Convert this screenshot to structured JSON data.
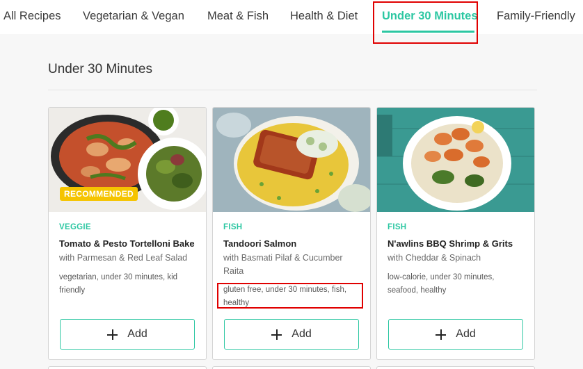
{
  "tabs": [
    "All Recipes",
    "Vegetarian & Vegan",
    "Meat & Fish",
    "Health & Diet",
    "Under 30 Minutes",
    "Family-Friendly"
  ],
  "section_title": "Under 30 Minutes",
  "cards": [
    {
      "badge": "RECOMMENDED",
      "category": "VEGGIE",
      "title": "Tomato & Pesto Tortelloni Bake",
      "subtitle": "with Parmesan & Red Leaf Salad",
      "tags": "vegetarian, under 30 minutes, kid friendly",
      "add_label": "Add"
    },
    {
      "category": "FISH",
      "title": "Tandoori Salmon",
      "subtitle": "with Basmati Pilaf & Cucumber Raita",
      "tags": "gluten free, under 30 minutes, fish, healthy",
      "add_label": "Add"
    },
    {
      "category": "FISH",
      "title": "N'awlins BBQ Shrimp & Grits",
      "subtitle": "with Cheddar & Spinach",
      "tags": "low-calorie, under 30 minutes, seafood, healthy",
      "add_label": "Add"
    }
  ],
  "colors": {
    "accent": "#2cc7a2",
    "badge": "#f5c400",
    "highlight": "#e00000"
  }
}
